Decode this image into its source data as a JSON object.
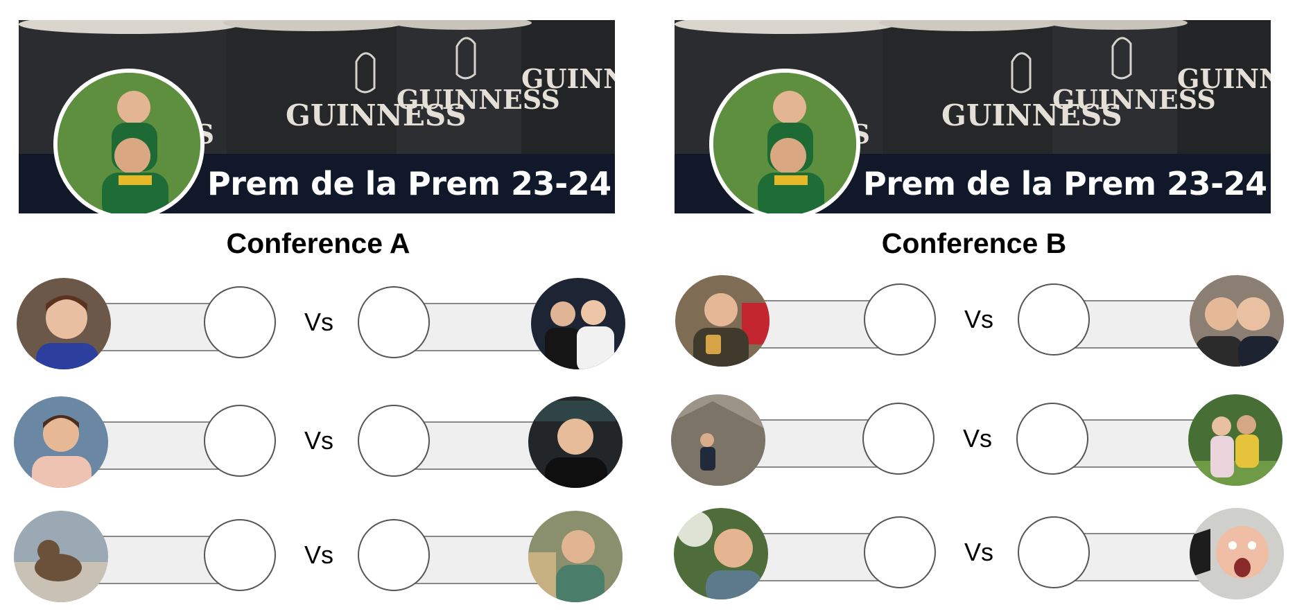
{
  "banner": {
    "title": "Prem de la Prem 23-24",
    "glass_logo_text": "GUINNESS"
  },
  "conferences": [
    {
      "title": "Conference A",
      "matches": [
        {
          "vs_label": "Vs",
          "home_score": "",
          "away_score": ""
        },
        {
          "vs_label": "Vs",
          "home_score": "",
          "away_score": ""
        },
        {
          "vs_label": "Vs",
          "home_score": "",
          "away_score": ""
        }
      ]
    },
    {
      "title": "Conference B",
      "matches": [
        {
          "vs_label": "Vs",
          "home_score": "",
          "away_score": ""
        },
        {
          "vs_label": "Vs",
          "home_score": "",
          "away_score": ""
        },
        {
          "vs_label": "Vs",
          "home_score": "",
          "away_score": ""
        }
      ]
    }
  ],
  "colors": {
    "banner_strip": "#101829",
    "bar_fill": "#efefef",
    "score_border": "#555555"
  }
}
